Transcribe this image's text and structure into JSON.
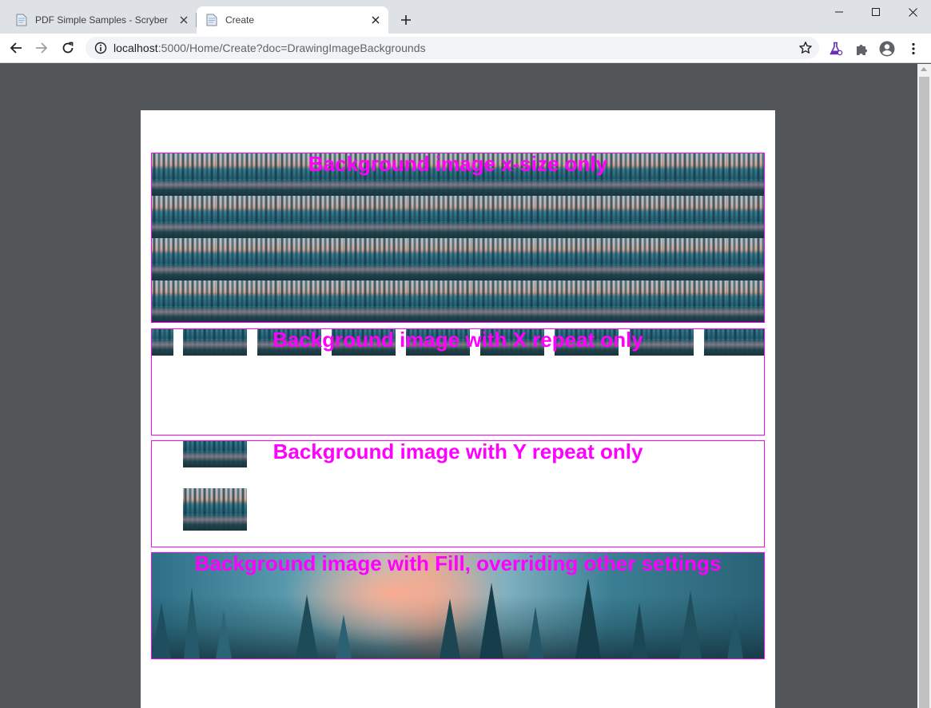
{
  "browser": {
    "tabs": [
      {
        "title": "PDF Simple Samples - Scryber",
        "active": false
      },
      {
        "title": "Create",
        "active": true
      }
    ],
    "url_host": "localhost",
    "url_rest": ":5000/Home/Create?doc=DrawingImageBackgrounds"
  },
  "colors": {
    "accent": "#ff00ff",
    "viewer_bg": "#525659"
  },
  "document": {
    "sections": [
      {
        "id": "x-size",
        "title": "Background image x-size only"
      },
      {
        "id": "x-repeat",
        "title": "Background image with X repeat only"
      },
      {
        "id": "y-repeat",
        "title": "Background image with Y repeat only"
      },
      {
        "id": "fill",
        "title": "Background image with Fill, overriding other settings"
      }
    ]
  },
  "icons": [
    "document-icon",
    "close-icon",
    "plus-icon",
    "minimize-icon",
    "maximize-icon",
    "window-close-icon",
    "back-icon",
    "forward-icon",
    "reload-icon",
    "info-icon",
    "star-icon",
    "labs-flask-icon",
    "puzzle-icon",
    "account-icon",
    "menu-icon"
  ]
}
